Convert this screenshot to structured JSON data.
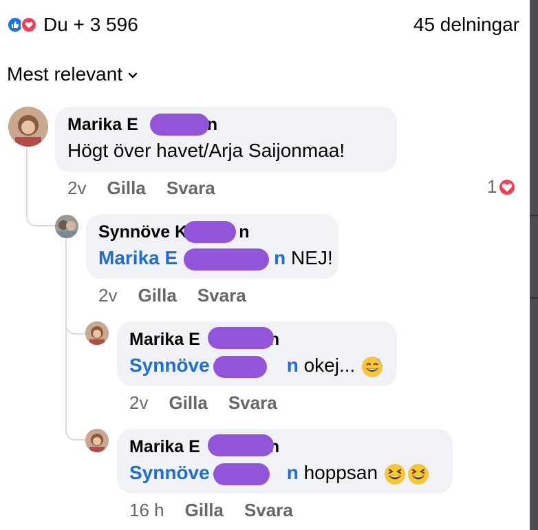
{
  "reactions": {
    "summary": "Du + 3 596",
    "shares": "45 delningar"
  },
  "sort": {
    "label": "Mest relevant"
  },
  "comments": [
    {
      "author": "Marika E    n",
      "text": "Högt över havet/Arja Saijonmaa!",
      "time": "2v",
      "like_label": "Gilla",
      "reply_label": "Svara",
      "reaction_count": "1"
    },
    {
      "author": "Synnöve K   n",
      "mention": "Marika E     n",
      "text": " NEJ!",
      "time": "2v",
      "like_label": "Gilla",
      "reply_label": "Svara"
    },
    {
      "author": "Marika E    n",
      "mention": "Synnöve K   n",
      "text": " okej... ",
      "emoji": "sweat-smile",
      "time": "2v",
      "like_label": "Gilla",
      "reply_label": "Svara"
    },
    {
      "author": "Marika E    n",
      "mention": "Synnöve K   n",
      "text": " hoppsan ",
      "emoji": "laughing",
      "time": "16 h",
      "like_label": "Gilla",
      "reply_label": "Svara"
    }
  ],
  "colors": {
    "like": "#1b74e4",
    "love": "#f33e58",
    "mention": "#1d6fd6",
    "bubble": "#f0f2f5",
    "redaction": "#9255d9"
  }
}
